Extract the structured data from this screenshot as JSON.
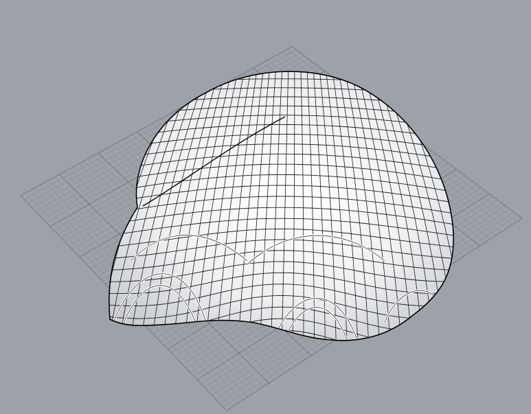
{
  "viewport": {
    "kind": "3d-perspective-viewport",
    "background_color": "#9da2a9",
    "grid_color": "#7f848b",
    "grid_major_color": "#6f747b",
    "shell_fill_color": "#f4f5f6",
    "shell_shade_color": "#c9ccd0",
    "panel_line_color": "#1a1a1a",
    "outline_color": "#000000"
  },
  "model": {
    "object": "paneled-shell-surface",
    "panel_rows": 26,
    "panel_cols": 34
  }
}
